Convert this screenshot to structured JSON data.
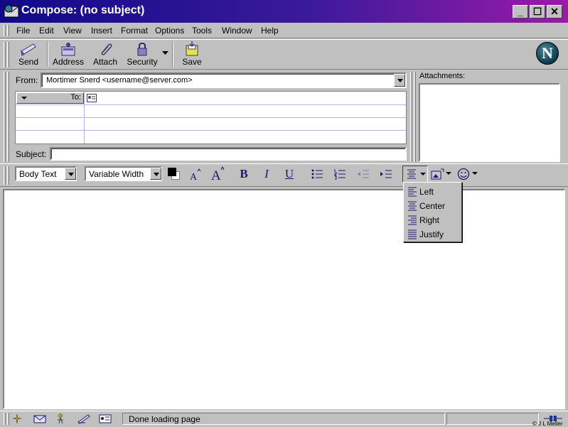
{
  "window": {
    "title": "Compose: (no subject)",
    "min_label": "_",
    "max_label": "☐",
    "close_label": "✕"
  },
  "menu": [
    "File",
    "Edit",
    "View",
    "Insert",
    "Format",
    "Options",
    "Tools",
    "Window",
    "Help"
  ],
  "toolbar": {
    "send": "Send",
    "address": "Address",
    "attach": "Attach",
    "security": "Security",
    "save": "Save",
    "logo": "N"
  },
  "address": {
    "from_label": "From:",
    "from_value": "Mortimer Snerd <username@server.com>",
    "to_label": "To:",
    "subject_label": "Subject:",
    "subject_value": ""
  },
  "attachments": {
    "label": "Attachments:"
  },
  "format": {
    "paragraph_style": "Body Text",
    "font": "Variable Width",
    "bold": "B",
    "italic": "I",
    "underline": "U"
  },
  "align_menu": [
    "Left",
    "Center",
    "Right",
    "Justify"
  ],
  "status": {
    "text": "Done loading page",
    "credit": "© J L Meller"
  },
  "colors": {
    "title_start": "#100a8a",
    "title_end": "#9b1aa9",
    "chrome": "#c0c0c0",
    "grid_line": "#b8b0e8"
  }
}
